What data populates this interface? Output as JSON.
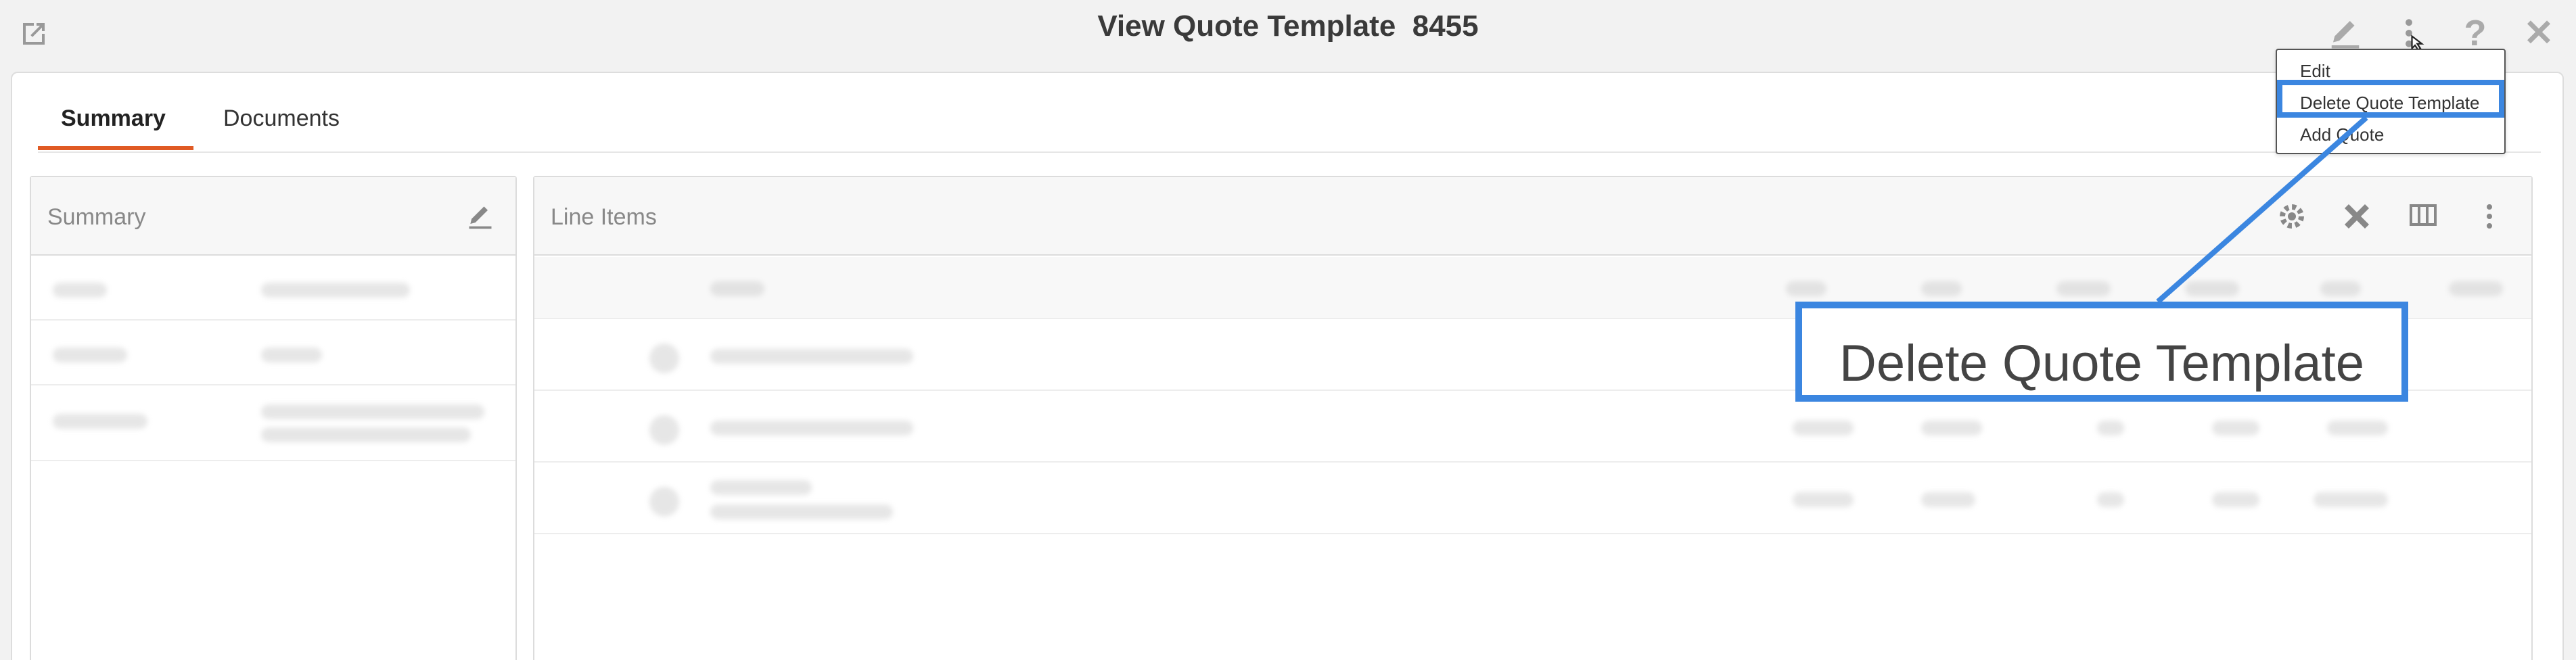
{
  "window": {
    "title": "View Quote Template  8455"
  },
  "toolbar": {
    "external_icon": "external-link-icon",
    "edit_icon": "pencil-icon",
    "more_icon": "vertical-dots-icon",
    "help_icon": "question-icon",
    "close_icon": "close-icon"
  },
  "tabs": [
    {
      "label": "Summary",
      "active": true
    },
    {
      "label": "Documents",
      "active": false
    }
  ],
  "summary_card": {
    "title": "Summary",
    "edit_icon": "pencil-icon"
  },
  "line_items_card": {
    "title": "Line Items",
    "icons": [
      "gear-icon",
      "tools-icon",
      "columns-icon",
      "vertical-dots-icon"
    ]
  },
  "dropdown_menu": {
    "items": [
      "Edit",
      "Delete Quote Template",
      "Add Quote"
    ],
    "highlighted": "Delete Quote Template"
  },
  "callout": {
    "text": "Delete Quote Template"
  },
  "colors": {
    "accent_tab": "#e05a24",
    "highlight": "#3b86e0"
  }
}
